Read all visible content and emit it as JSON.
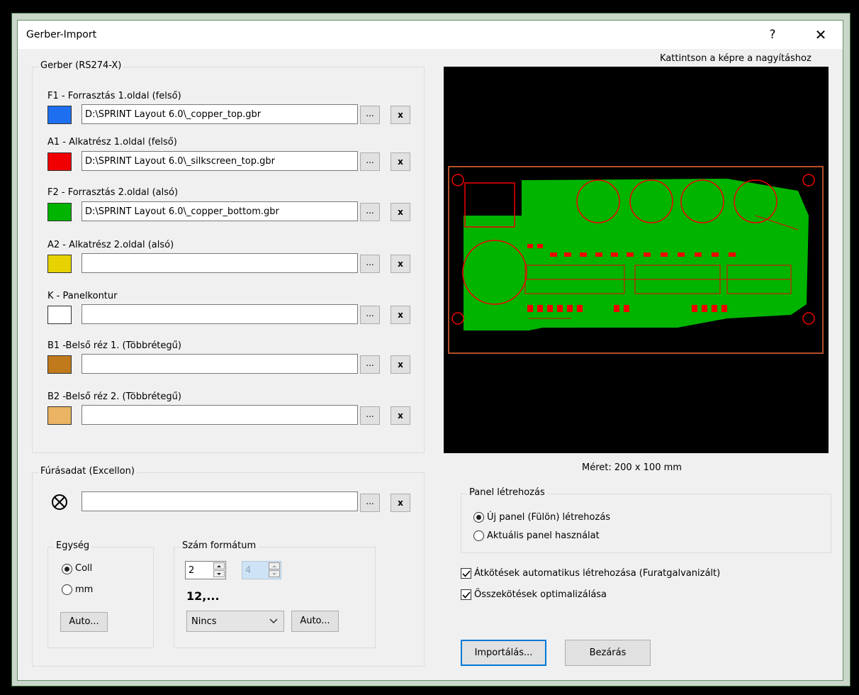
{
  "window": {
    "title": "Gerber-Import",
    "help": "?",
    "close": "✕"
  },
  "gerber": {
    "legend": "Gerber (RS274-X)",
    "browse_label": "...",
    "clear_label": "x",
    "layers": [
      {
        "label": "F1 - Forrasztás 1.oldal (felső)",
        "color": "#1e6ff0",
        "path": "D:\\SPRINT Layout 6.0\\_copper_top.gbr"
      },
      {
        "label": "A1 - Alkatrész 1.oldal (felső)",
        "color": "#f00000",
        "path": "D:\\SPRINT Layout 6.0\\_silkscreen_top.gbr"
      },
      {
        "label": "F2 - Forrasztás 2.oldal (alsó)",
        "color": "#00b400",
        "path": "D:\\SPRINT Layout 6.0\\_copper_bottom.gbr"
      },
      {
        "label": "A2 - Alkatrész 2.oldal (alsó)",
        "color": "#e6d200",
        "path": ""
      },
      {
        "label": "K - Panelkontur",
        "color": "#ffffff",
        "path": ""
      },
      {
        "label": "B1 -Belső réz 1. (Többrétegű)",
        "color": "#c07a1c",
        "path": ""
      },
      {
        "label": "B2 -Belső réz 2. (Többrétegű)",
        "color": "#eab464",
        "path": ""
      }
    ]
  },
  "drill": {
    "legend": "Fúrásadat (Excellon)",
    "icon": "circle-x-icon",
    "path": "",
    "unit": {
      "legend": "Egység",
      "options": [
        {
          "label": "Coll",
          "selected": true
        },
        {
          "label": "mm",
          "selected": false
        }
      ],
      "auto_label": "Auto..."
    },
    "number_format": {
      "legend": "Szám formátum",
      "integer_digits": "2",
      "decimal_digits": "4",
      "example": "12,...",
      "zero_suppression": "Nincs",
      "auto_label": "Auto..."
    }
  },
  "preview": {
    "hint": "Kattintson a képre a nagyításhoz",
    "size_text": "Méret: 200 x 100 mm",
    "colors": {
      "background": "#000000",
      "copper_bottom": "#00b400",
      "silkscreen": "#f00000",
      "outline": "#b4502a"
    }
  },
  "panel": {
    "legend": "Panel létrehozás",
    "options": [
      {
        "label": "Új panel (Fülön) létrehozás",
        "selected": true
      },
      {
        "label": "Aktuális panel használat",
        "selected": false
      }
    ]
  },
  "options": [
    {
      "label": "Átkötések automatikus létrehozása (Furatgalvanizált)",
      "checked": true
    },
    {
      "label": "Összekötések optimalizálása",
      "checked": true
    }
  ],
  "buttons": {
    "import": "Importálás...",
    "close": "Bezárás"
  }
}
